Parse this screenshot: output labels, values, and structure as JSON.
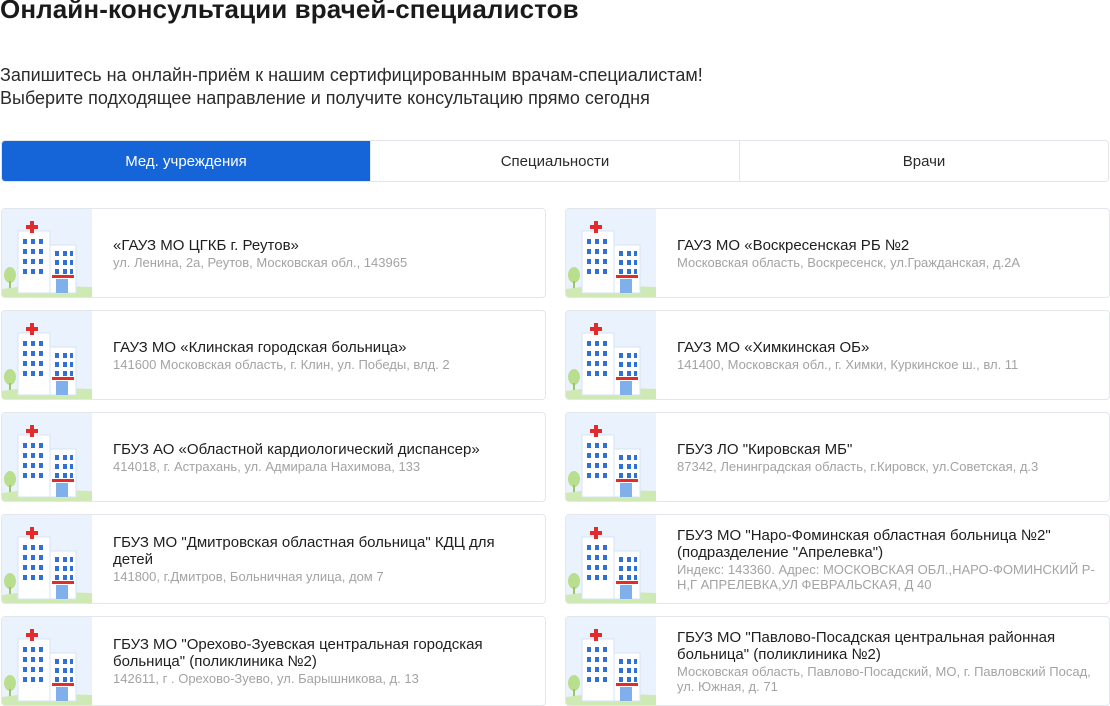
{
  "page": {
    "title": "Онлайн-консультации врачей-специалистов",
    "intro_line1": "Запишитесь на онлайн-приём к нашим сертифицированным врачам-специалистам!",
    "intro_line2": "Выберите подходящее направление и получите консультацию прямо сегодня"
  },
  "tabs": [
    {
      "label": "Мед. учреждения",
      "active": true
    },
    {
      "label": "Специальности",
      "active": false
    },
    {
      "label": "Врачи",
      "active": false
    }
  ],
  "colors": {
    "accent": "#1565d8",
    "thumb_bg": "#eaf3fd",
    "cross": "#e32b2b"
  },
  "icon": "hospital-building-icon",
  "facilities": [
    {
      "name": "«ГАУЗ МО ЦГКБ г. Реутов»",
      "address": "ул. Ленина, 2а, Реутов, Московская обл., 143965"
    },
    {
      "name": "ГАУЗ МО «Воскресенская РБ №2",
      "address": "Московская область, Воскресенск, ул.Гражданская, д.2А"
    },
    {
      "name": "ГАУЗ МО «Клинская городская больница»",
      "address": "141600 Московская область, г. Клин, ул. Победы, влд. 2"
    },
    {
      "name": "ГАУЗ МО «Химкинская ОБ»",
      "address": "141400, Московская обл., г. Химки, Куркинское ш., вл. 11"
    },
    {
      "name": "ГБУЗ АО «Областной кардиологический диспансер»",
      "address": "414018, г. Астрахань, ул. Адмирала Нахимова, 133"
    },
    {
      "name": "ГБУЗ ЛО \"Кировская МБ\"",
      "address": "87342, Ленинградская область, г.Кировск, ул.Советская, д.3"
    },
    {
      "name": "ГБУЗ МО \"Дмитровская областная больница\" КДЦ для детей",
      "address": "141800, г.Дмитров, Больничная улица, дом 7"
    },
    {
      "name": "ГБУЗ МО \"Наро-Фоминская областная больница №2\" (подразделение \"Апрелевка\")",
      "address": "Индекс: 143360. Адрес: МОСКОВСКАЯ ОБЛ.,НАРО-ФОМИНСКИЙ Р-Н,Г АПРЕЛЕВКА,УЛ ФЕВРАЛЬСКАЯ, Д 40"
    },
    {
      "name": "ГБУЗ МО \"Орехово-Зуевская центральная городская больница\" (поликлиника №2)",
      "address": "142611, г . Орехово-Зуево, ул. Барышникова, д. 13"
    },
    {
      "name": "ГБУЗ МО \"Павлово-Посадская центральная районная больница\" (поликлиника №2)",
      "address": "Московская область, Павлово-Посадский, МО, г. Павловский Посад, ул. Южная, д. 71"
    }
  ]
}
